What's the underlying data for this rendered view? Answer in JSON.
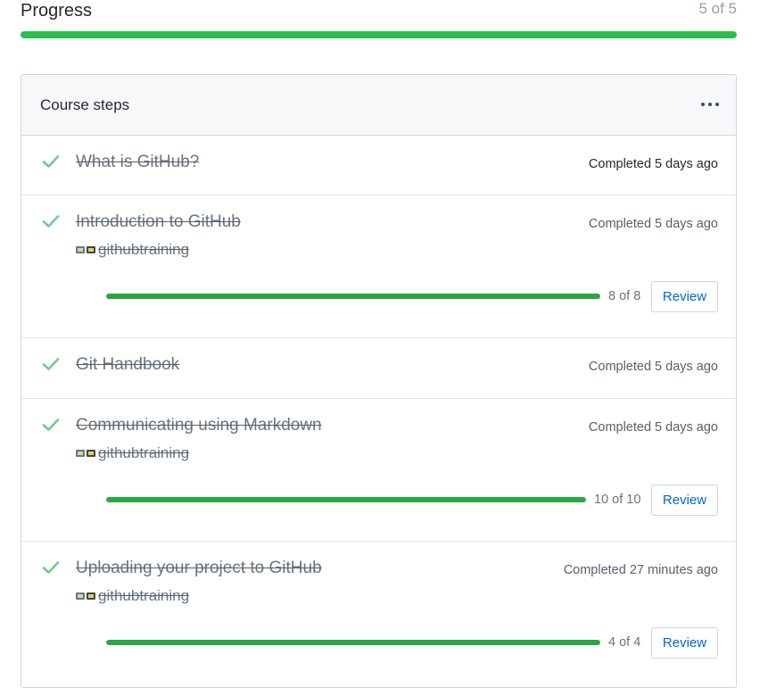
{
  "progress": {
    "title": "Progress",
    "count_label": "5 of 5",
    "fraction": 1.0
  },
  "course": {
    "title": "Course steps",
    "steps": [
      {
        "title": "What is GitHub?",
        "status": "Completed 5 days ago"
      },
      {
        "title": "Introduction to GitHub",
        "status": "Completed 5 days ago",
        "owner": "githubtraining",
        "count_label": "8 of 8",
        "fraction": 1.0,
        "review_label": "Review"
      },
      {
        "title": "Git Handbook",
        "status": "Completed 5 days ago"
      },
      {
        "title": "Communicating using Markdown",
        "status": "Completed 5 days ago",
        "owner": "githubtraining",
        "count_label": "10 of 10",
        "fraction": 1.0,
        "review_label": "Review"
      },
      {
        "title": "Uploading your project to GitHub",
        "status": "Completed 27 minutes ago",
        "owner": "githubtraining",
        "count_label": "4 of 4",
        "fraction": 1.0,
        "review_label": "Review"
      }
    ]
  },
  "icons": {
    "check": "check-icon",
    "more": "kebab-horizontal-icon",
    "avatar": "githubtraining-avatar"
  },
  "colors": {
    "success": "#2cbe4e",
    "link": "#0366d6",
    "muted": "#586069"
  }
}
